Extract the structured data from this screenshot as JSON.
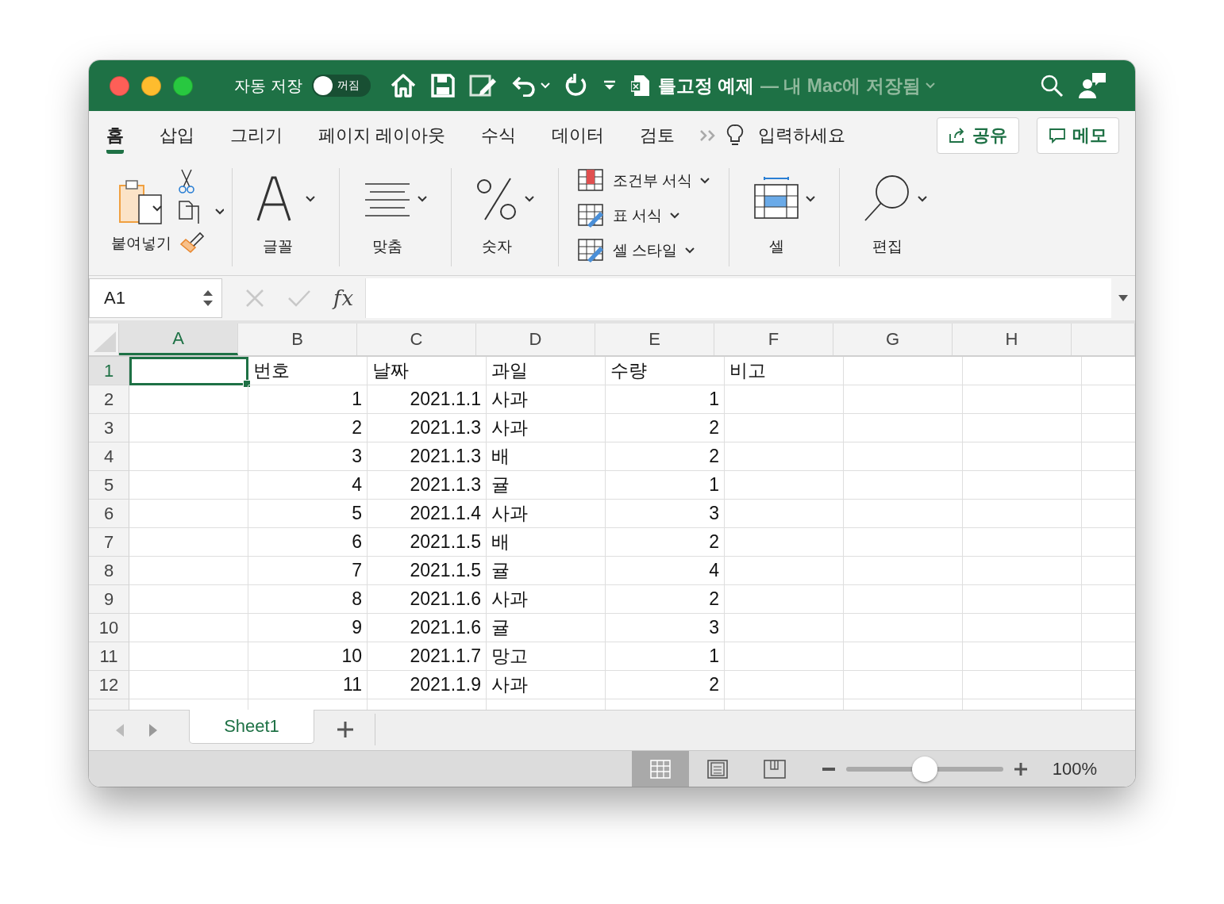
{
  "window": {
    "title": "틀고정 예제",
    "subtitle": "— 내 Mac에 저장됨"
  },
  "autosave": {
    "label": "자동 저장",
    "toggle_label": "꺼짐",
    "on": false
  },
  "ribbon_tabs": [
    {
      "label": "홈",
      "selected": true
    },
    {
      "label": "삽입",
      "selected": false
    },
    {
      "label": "그리기",
      "selected": false
    },
    {
      "label": "페이지 레이아웃",
      "selected": false
    },
    {
      "label": "수식",
      "selected": false
    },
    {
      "label": "데이터",
      "selected": false
    },
    {
      "label": "검토",
      "selected": false
    }
  ],
  "tell_me": "입력하세요",
  "share_button": "공유",
  "comments_button": "메모",
  "ribbon": {
    "paste": "붙여넣기",
    "font": "글꼴",
    "alignment": "맞춤",
    "number": "숫자",
    "styles": [
      "조건부 서식",
      "표 서식",
      "셀 스타일"
    ],
    "cells": "셀",
    "editing": "편집"
  },
  "name_box": "A1",
  "function_button": "fx",
  "columns": [
    {
      "label": "A",
      "selected": true,
      "kind": "text"
    },
    {
      "label": "B",
      "selected": false,
      "kind": "number"
    },
    {
      "label": "C",
      "selected": false,
      "kind": "number"
    },
    {
      "label": "D",
      "selected": false,
      "kind": "text"
    },
    {
      "label": "E",
      "selected": false,
      "kind": "number"
    },
    {
      "label": "F",
      "selected": false,
      "kind": "text"
    },
    {
      "label": "G",
      "selected": false,
      "kind": "text"
    },
    {
      "label": "H",
      "selected": false,
      "kind": "text"
    }
  ],
  "rows": [
    {
      "label": "1",
      "kind": "header",
      "selected": true,
      "cells": [
        "",
        "번호",
        "날짜",
        "과일",
        "수량",
        "비고"
      ]
    },
    {
      "label": "2",
      "kind": "data",
      "selected": false,
      "cells": [
        "",
        "1",
        "2021.1.1",
        "사과",
        "1",
        ""
      ]
    },
    {
      "label": "3",
      "kind": "data",
      "selected": false,
      "cells": [
        "",
        "2",
        "2021.1.3",
        "사과",
        "2",
        ""
      ]
    },
    {
      "label": "4",
      "kind": "data",
      "selected": false,
      "cells": [
        "",
        "3",
        "2021.1.3",
        "배",
        "2",
        ""
      ]
    },
    {
      "label": "5",
      "kind": "data",
      "selected": false,
      "cells": [
        "",
        "4",
        "2021.1.3",
        "귤",
        "1",
        ""
      ]
    },
    {
      "label": "6",
      "kind": "data",
      "selected": false,
      "cells": [
        "",
        "5",
        "2021.1.4",
        "사과",
        "3",
        ""
      ]
    },
    {
      "label": "7",
      "kind": "data",
      "selected": false,
      "cells": [
        "",
        "6",
        "2021.1.5",
        "배",
        "2",
        ""
      ]
    },
    {
      "label": "8",
      "kind": "data",
      "selected": false,
      "cells": [
        "",
        "7",
        "2021.1.5",
        "귤",
        "4",
        ""
      ]
    },
    {
      "label": "9",
      "kind": "data",
      "selected": false,
      "cells": [
        "",
        "8",
        "2021.1.6",
        "사과",
        "2",
        ""
      ]
    },
    {
      "label": "10",
      "kind": "data",
      "selected": false,
      "cells": [
        "",
        "9",
        "2021.1.6",
        "귤",
        "3",
        ""
      ]
    },
    {
      "label": "11",
      "kind": "data",
      "selected": false,
      "cells": [
        "",
        "10",
        "2021.1.7",
        "망고",
        "1",
        ""
      ]
    },
    {
      "label": "12",
      "kind": "data",
      "selected": false,
      "cells": [
        "",
        "11",
        "2021.1.9",
        "사과",
        "2",
        ""
      ]
    }
  ],
  "sheet_tabs": [
    {
      "label": "Sheet1",
      "selected": true
    }
  ],
  "view_buttons": [
    {
      "kind": "normal",
      "selected": true
    },
    {
      "kind": "page-layout",
      "selected": false
    },
    {
      "kind": "page-break",
      "selected": false
    }
  ],
  "zoom": {
    "level": 0.5,
    "reading": "100%"
  }
}
